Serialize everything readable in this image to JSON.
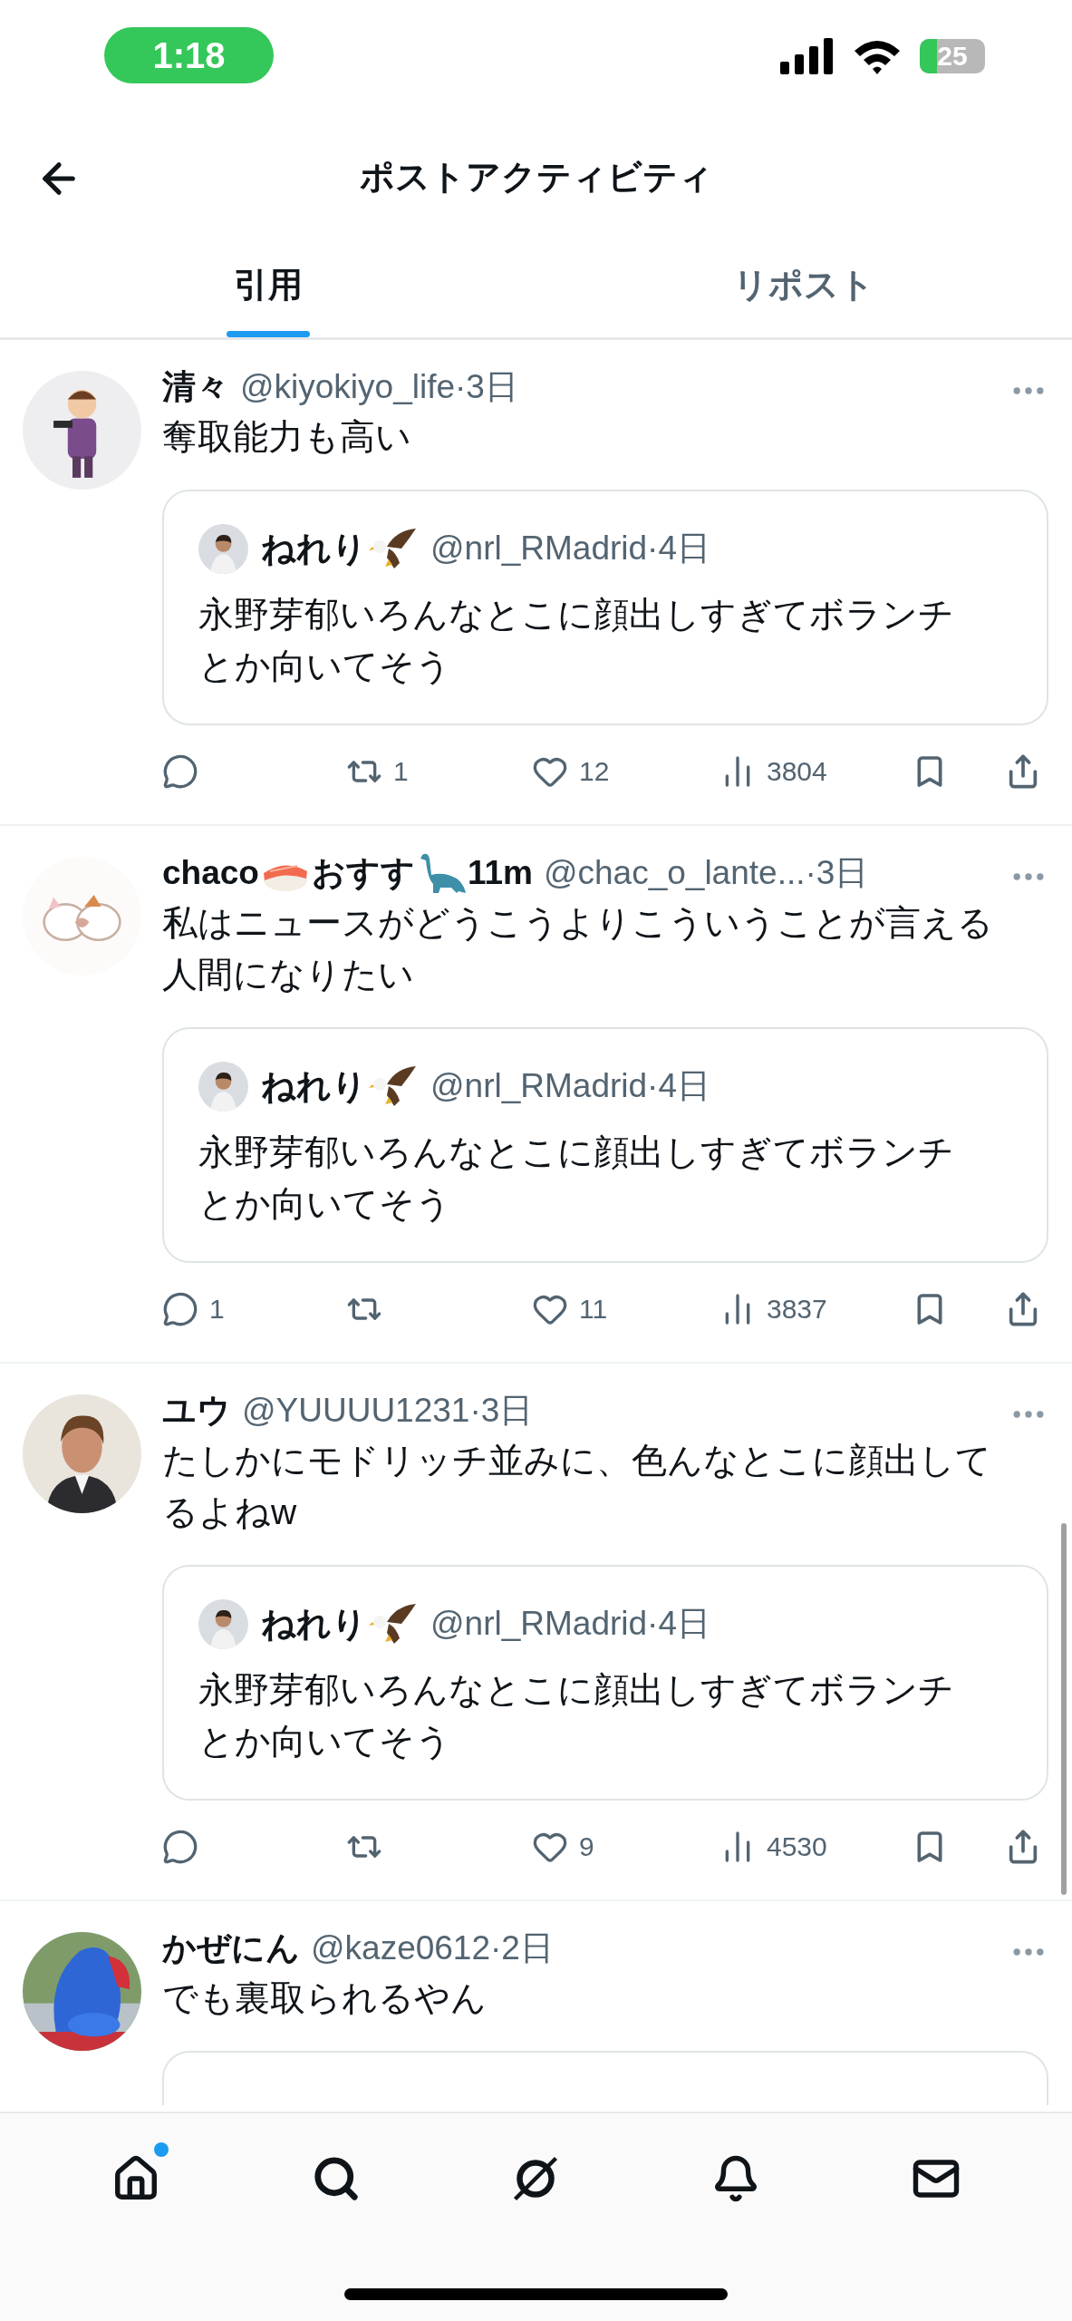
{
  "status_bar": {
    "time": "1:18",
    "battery": "25"
  },
  "header": {
    "title": "ポストアクティビティ"
  },
  "tabs": [
    {
      "label": "引用",
      "selected": true
    },
    {
      "label": "リポスト",
      "selected": false
    }
  ],
  "posts": [
    {
      "avatar": {
        "kind": "picture"
      },
      "name": [
        {
          "kind": "text",
          "text": "清々"
        }
      ],
      "handle_line": "@kiyokiyo_life·3日",
      "text": "奪取能力も高い",
      "quote": {
        "name": [
          {
            "kind": "text",
            "text": "ねれり"
          },
          {
            "kind": "eagle"
          }
        ],
        "handle_line": "@nrl_RMadrid·4日",
        "text": "永野芽郁いろんなとこに顔出しすぎてボランチとか向いてそう"
      },
      "actions": {
        "reposts": "1",
        "likes": "12",
        "views": "3804"
      }
    },
    {
      "avatar": {
        "kind": "picture"
      },
      "name": [
        {
          "kind": "text",
          "text": "chaco"
        },
        {
          "kind": "sushi"
        },
        {
          "kind": "text",
          "text": "おすす"
        },
        {
          "kind": "dinosaur"
        },
        {
          "kind": "text",
          "text": "11m"
        }
      ],
      "handle_line": "@chac_o_lante...·3日",
      "text": "私はニュースがどうこうよりこういうことが言える人間になりたい",
      "quote": {
        "name": [
          {
            "kind": "text",
            "text": "ねれり"
          },
          {
            "kind": "eagle"
          }
        ],
        "handle_line": "@nrl_RMadrid·4日",
        "text": "永野芽郁いろんなとこに顔出しすぎてボランチとか向いてそう"
      },
      "actions": {
        "replies": "1",
        "likes": "11",
        "views": "3837"
      }
    },
    {
      "avatar": {
        "kind": "picture"
      },
      "name": [
        {
          "kind": "text",
          "text": "ユウ"
        }
      ],
      "handle_line": "@YUUUU1231·3日",
      "text": "たしかにモドリッチ並みに、色んなとこに顔出してるよねw",
      "quote": {
        "name": [
          {
            "kind": "text",
            "text": "ねれり"
          },
          {
            "kind": "eagle"
          }
        ],
        "handle_line": "@nrl_RMadrid·4日",
        "text": "永野芽郁いろんなとこに顔出しすぎてボランチとか向いてそう"
      },
      "actions": {
        "likes": "9",
        "views": "4530"
      }
    },
    {
      "avatar": {
        "kind": "picture"
      },
      "name": [
        {
          "kind": "text",
          "text": "かぜにん"
        }
      ],
      "handle_line": "@kaze0612·2日",
      "text": "でも裏取られるやん",
      "quote": {
        "kind": "edge"
      }
    }
  ],
  "nav": [
    {
      "kind": "home",
      "badge": true
    },
    {
      "kind": "search",
      "badge": false
    },
    {
      "kind": "slash-circle",
      "badge": false
    },
    {
      "kind": "bell",
      "badge": false
    },
    {
      "kind": "mail",
      "badge": false
    }
  ]
}
